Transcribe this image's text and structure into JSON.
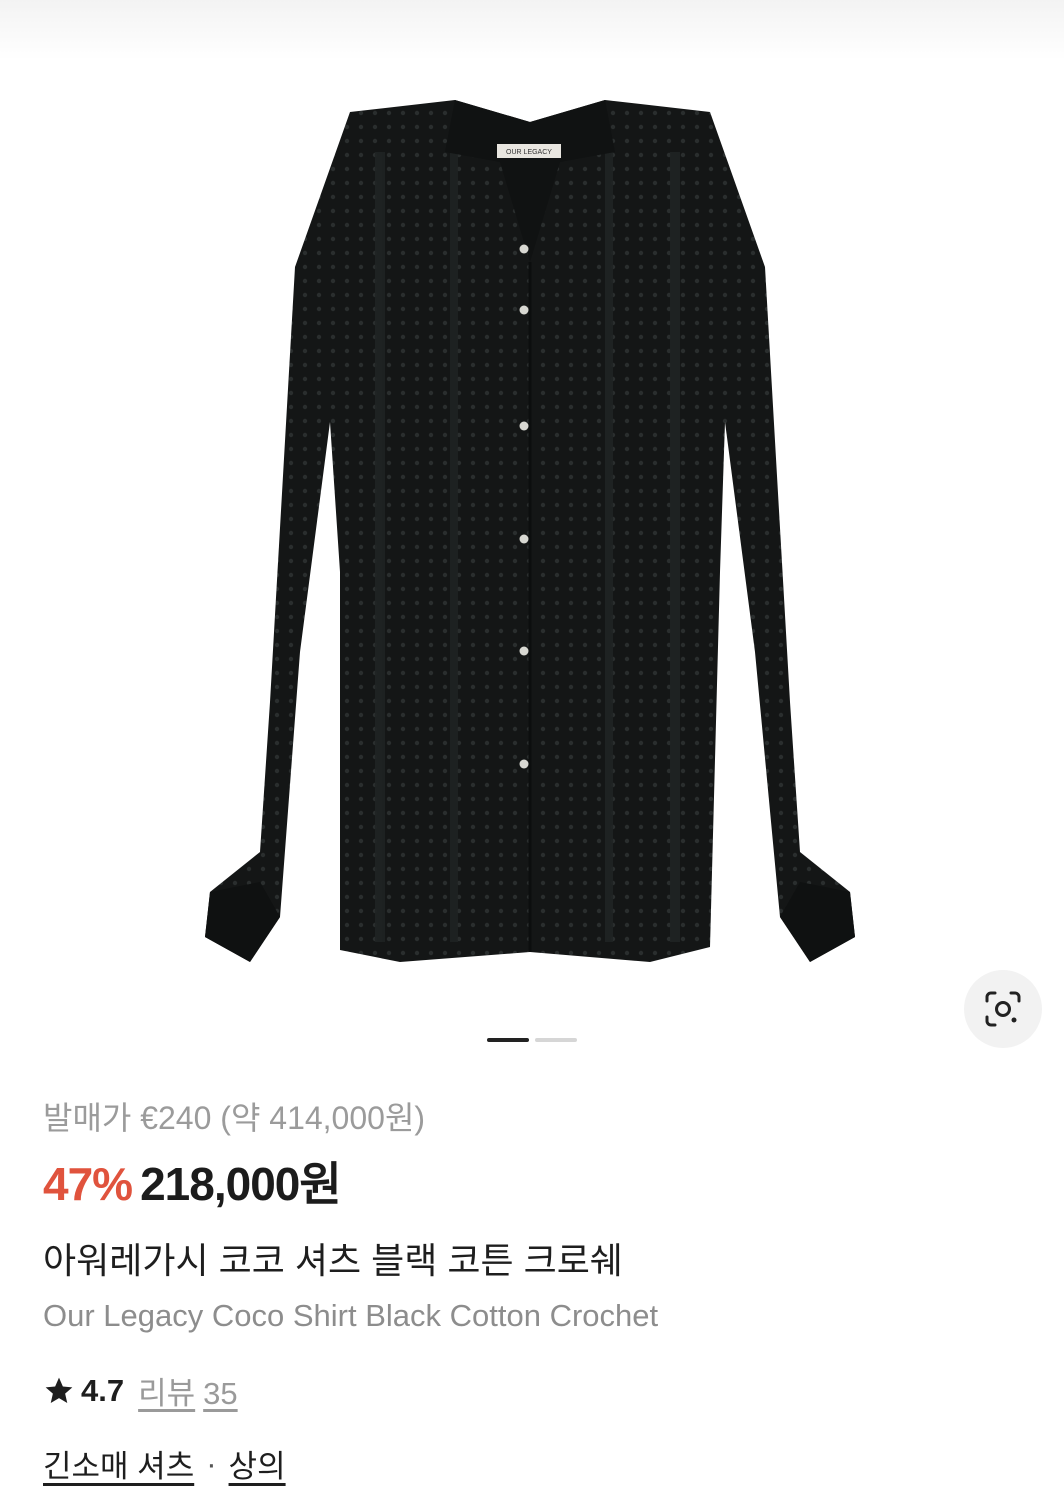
{
  "product_image": {
    "label_tag": "OUR LEGACY",
    "pager": {
      "total": 2,
      "current": 1
    }
  },
  "price": {
    "original": "발매가 €240 (약 414,000원)",
    "discount": "47%",
    "sale": "218,000원"
  },
  "product": {
    "name_ko": "아워레가시 코코 셔츠 블랙 코튼 크로쉐",
    "name_en": "Our Legacy Coco Shirt Black Cotton Crochet"
  },
  "rating": {
    "value": "4.7",
    "review_label": "리뷰",
    "review_count": "35"
  },
  "category": {
    "sub": "긴소매 셔츠",
    "separator": "·",
    "main": "상의"
  },
  "icons": {
    "lens": "image-search-icon",
    "star": "star-icon"
  },
  "colors": {
    "discount": "#e0533d",
    "text": "#1e1e1e",
    "muted": "#9b9b9b"
  }
}
